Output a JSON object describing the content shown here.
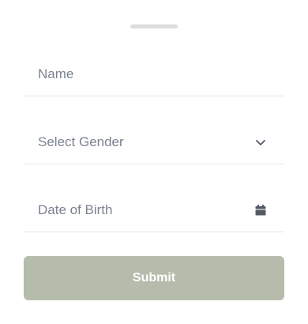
{
  "form": {
    "name_placeholder": "Name",
    "gender_placeholder": "Select Gender",
    "dob_placeholder": "Date of Birth",
    "submit_label": "Submit"
  },
  "icons": {
    "gender_dropdown": "chevron-down-icon",
    "dob_picker": "calendar-icon"
  },
  "colors": {
    "submit_background": "#b6bcab",
    "placeholder_text": "#7a8290",
    "handle": "#dcdcdc",
    "divider": "#e6e6e6"
  }
}
